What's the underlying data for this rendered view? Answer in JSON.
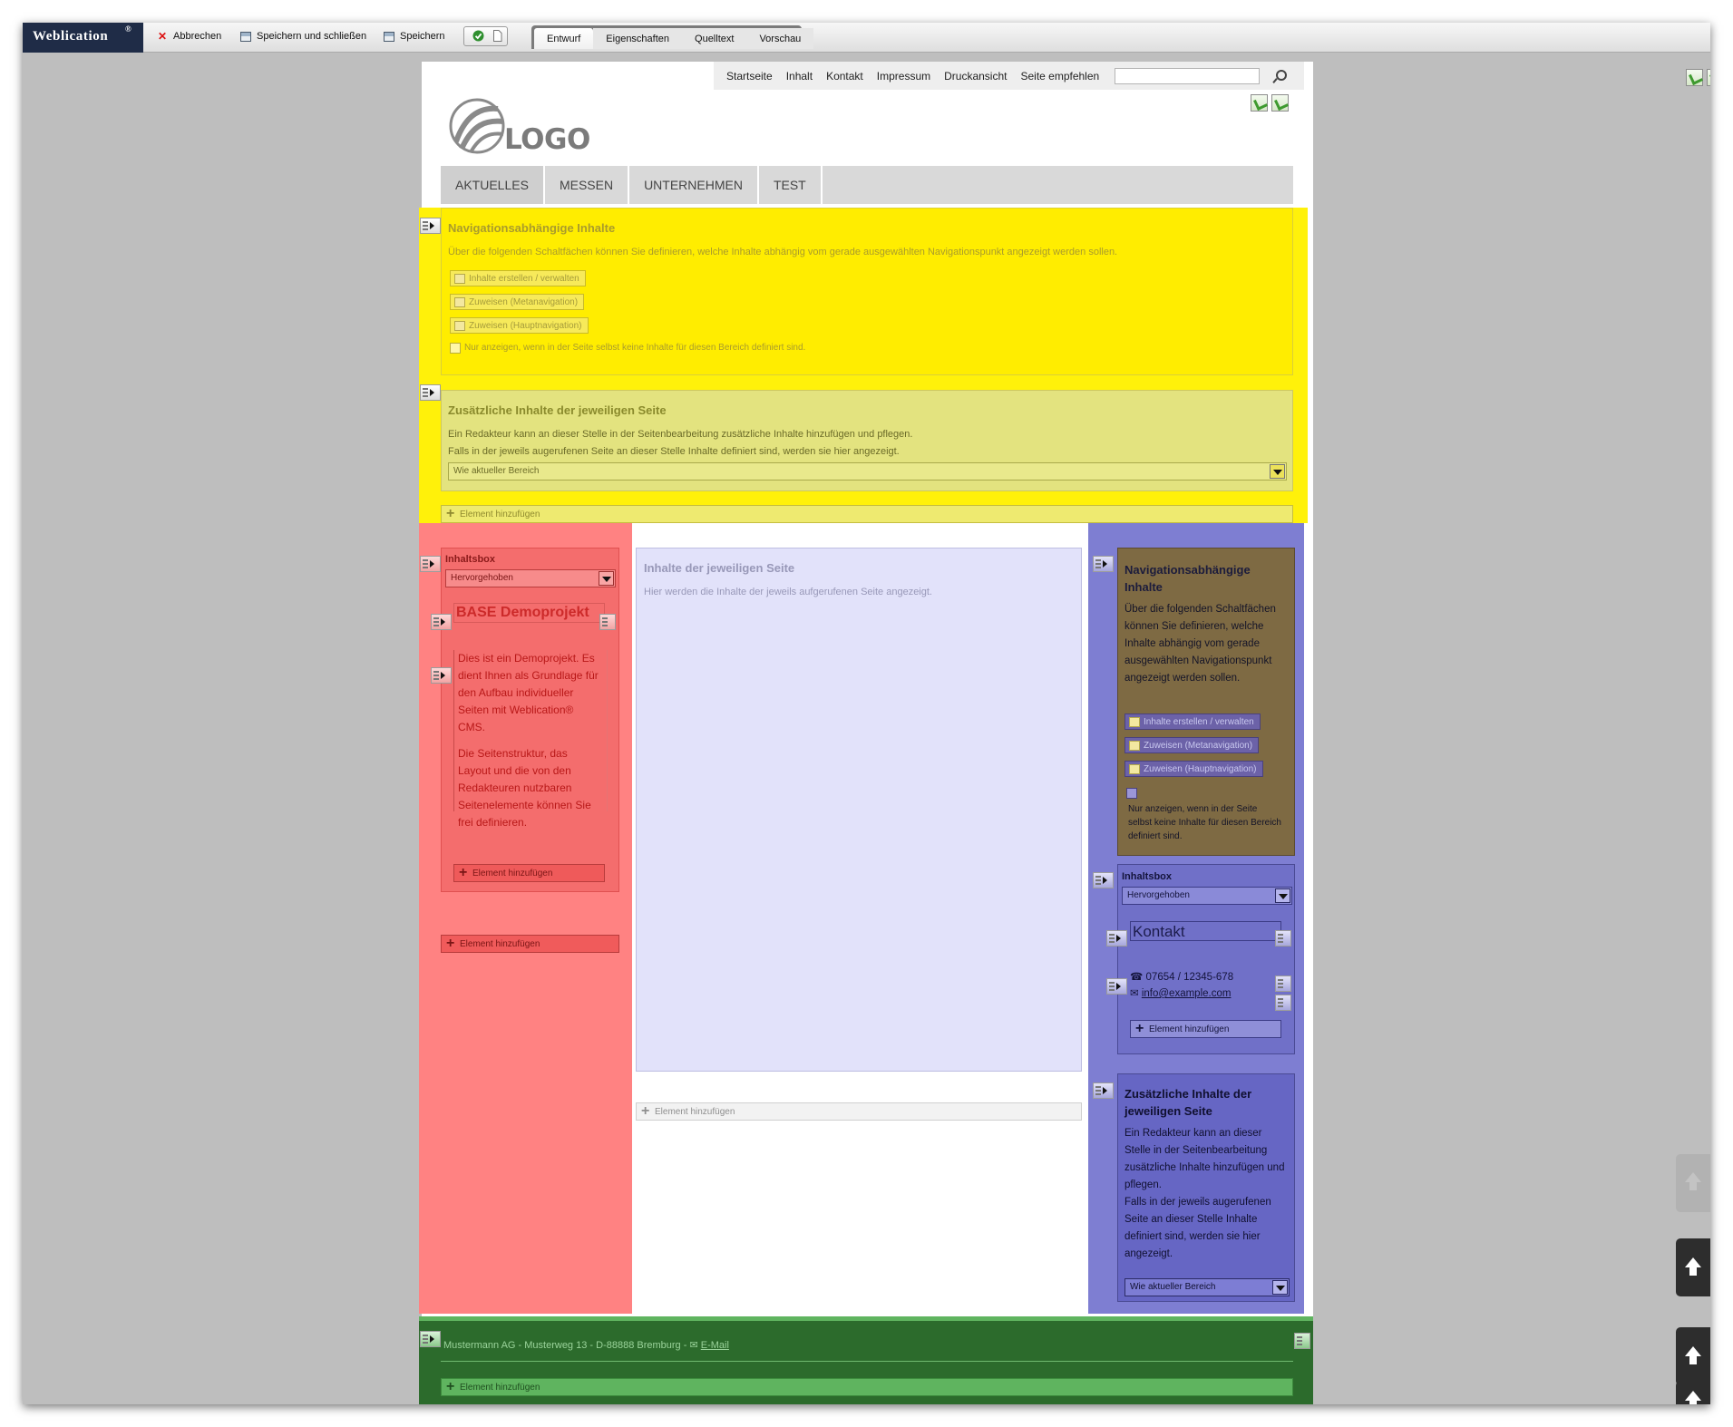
{
  "toolbar": {
    "brand": "Weblication",
    "brand_mark": "®",
    "cancel_label": "Abbrechen",
    "save_close_label": "Speichern und schließen",
    "save_label": "Speichern",
    "tabs": [
      {
        "label": "Entwurf",
        "active": true
      },
      {
        "label": "Eigenschaften",
        "active": false
      },
      {
        "label": "Quelltext",
        "active": false
      },
      {
        "label": "Vorschau",
        "active": false
      }
    ]
  },
  "meta_nav": {
    "items": [
      "Startseite",
      "Inhalt",
      "Kontakt",
      "Impressum",
      "Druckansicht",
      "Seite empfehlen"
    ],
    "search_value": ""
  },
  "logo": {
    "text": "LOGO"
  },
  "main_nav": {
    "items": [
      "AKTUELLES",
      "MESSEN",
      "UNTERNEHMEN",
      "TEST"
    ]
  },
  "nav_content": {
    "title": "Navigationsabhängige Inhalte",
    "description": "Über die folgenden Schaltfächen können Sie definieren, welche Inhalte abhängig vom gerade ausgewählten Navigationspunkt angezeigt werden sollen.",
    "btn_manage": "Inhalte erstellen / verwalten",
    "btn_meta": "Zuweisen (Metanavigation)",
    "btn_main": "Zuweisen (Hauptnavigation)",
    "checkbox_label": "Nur anzeigen, wenn in der Seite selbst keine Inhalte für diesen Bereich definiert sind."
  },
  "additional_content": {
    "title": "Zusätzliche Inhalte der jeweiligen Seite",
    "line1": "Ein Redakteur kann an dieser Stelle in der Seitenbearbeitung zusätzliche Inhalte hinzufügen und pflegen.",
    "line2": "Falls in der jeweils augerufenen Seite an dieser Stelle Inhalte definiert sind, werden sie hier angezeigt.",
    "select_value": "Wie aktueller Bereich"
  },
  "add_element_label": "Element hinzufügen",
  "left_col": {
    "box_label": "Inhaltsbox",
    "box_select": "Hervorgehoben",
    "heading": "BASE Demoprojekt",
    "para1": "Dies ist ein Demoprojekt. Es dient Ihnen als Grundlage für den Aufbau individueller Seiten mit Weblication® CMS.",
    "para2": "Die Seitenstruktur, das Layout und die von den Redakteuren nutzbaren Seitenelemente können Sie frei definieren."
  },
  "center_col": {
    "title": "Inhalte der jeweiligen Seite",
    "text": "Hier werden die Inhalte der jeweils aufgerufenen Seite angezeigt."
  },
  "right_col": {
    "nav_title": "Navigationsabhängige Inhalte",
    "nav_text": "Über die folgenden Schaltfächen können Sie definieren, welche Inhalte abhängig vom gerade ausgewählten Navigationspunkt angezeigt werden sollen.",
    "checkbox_label": "Nur anzeigen, wenn in der Seite selbst keine Inhalte für diesen Bereich definiert sind.",
    "box_label": "Inhaltsbox",
    "box_select": "Hervorgehoben",
    "contact_heading": "Kontakt",
    "phone": "07654 / 12345-678",
    "email": "info@example.com",
    "add_title": "Zusätzliche Inhalte der jeweiligen Seite",
    "add_text1": "Ein Redakteur kann an dieser Stelle in der Seitenbearbeitung zusätzliche Inhalte hinzufügen und pflegen.",
    "add_text2": "Falls in der jeweils augerufenen Seite an dieser Stelle Inhalte definiert sind, werden sie hier angezeigt.",
    "add_select": "Wie aktueller Bereich"
  },
  "footer": {
    "address": "Mustermann AG - Musterweg 13 - D-88888 Bremburg -",
    "email_link": "E-Mail"
  },
  "colors": {
    "brand_bg": "#1f2c47",
    "yellow_zone": "#ffed00",
    "red_zone": "#ff8282",
    "blue_zone": "#7e7ed2",
    "green_zone": "#2c6b2c"
  }
}
